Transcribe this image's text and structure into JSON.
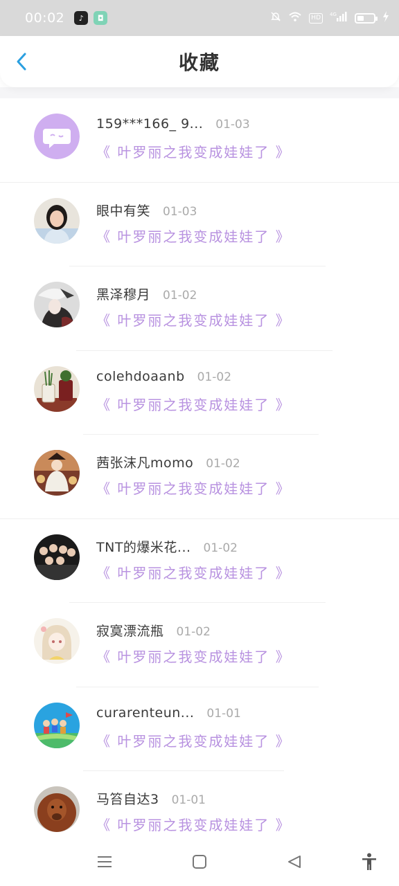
{
  "status": {
    "time": "00:02",
    "hd": "HD",
    "net": "4G"
  },
  "header": {
    "title": "收藏"
  },
  "items": [
    {
      "name": "159***166_ 9...",
      "date": "01-03",
      "book": "《 叶罗丽之我变成娃娃了 》"
    },
    {
      "name": "眼中有笑",
      "date": "01-03",
      "book": "《 叶罗丽之我变成娃娃了 》"
    },
    {
      "name": "黑泽穆月",
      "date": "01-02",
      "book": "《 叶罗丽之我变成娃娃了 》"
    },
    {
      "name": "colehdoaanb",
      "date": "01-02",
      "book": "《 叶罗丽之我变成娃娃了 》"
    },
    {
      "name": "茜张沫凡momo",
      "date": "01-02",
      "book": "《 叶罗丽之我变成娃娃了 》"
    },
    {
      "name": "TNT的爆米花...",
      "date": "01-02",
      "book": "《 叶罗丽之我变成娃娃了 》"
    },
    {
      "name": "寂寞漂流瓶",
      "date": "01-02",
      "book": "《 叶罗丽之我变成娃娃了 》"
    },
    {
      "name": "curarenteun...",
      "date": "01-01",
      "book": "《 叶罗丽之我变成娃娃了 》"
    },
    {
      "name": "马笞自达3",
      "date": "01-01",
      "book": "《 叶罗丽之我变成娃娃了 》"
    }
  ],
  "colors": {
    "accent": "#2a9fe0",
    "book_title": "#b892e0",
    "status_bar": "#d9d9d9"
  },
  "icons": {
    "back": "chevron-left-icon",
    "menu": "menu-icon",
    "home": "home-square-icon",
    "navback": "triangle-back-icon",
    "accessibility": "accessibility-icon"
  }
}
